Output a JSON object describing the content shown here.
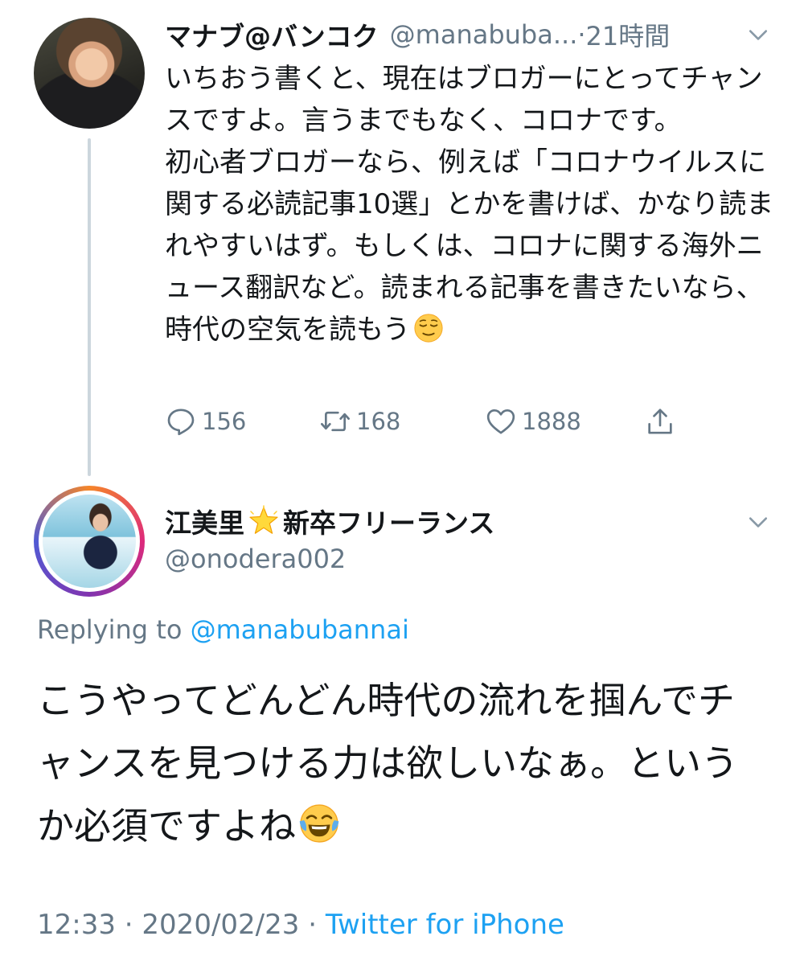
{
  "tweet1": {
    "author_name": "マナブ@バンコク",
    "author_handle": "@manabuba...",
    "time_separator": " · ",
    "time": "21時間",
    "body": "いちおう書くと、現在はブロガーにとってチャンスですよ。言うまでもなく、コロナです。\n初心者ブロガーなら、例えば「コロナウイルスに関する必読記事10選」とかを書けば、かなり読まれやすいはず。もしくは、コロナに関する海外ニュース翻訳など。読まれる記事を書きたいなら、時代の空気を読もう",
    "body_emoji": "relieved-face-emoji",
    "reply_count": "156",
    "retweet_count": "168",
    "like_count": "1888"
  },
  "tweet2": {
    "author_name_part1": "江美里",
    "name_emoji": "glowing-star-emoji",
    "author_name_part2": "新卒フリーランス",
    "author_handle": "@onodera002",
    "replying_prefix": "Replying to ",
    "replying_handle": "@manabubannai",
    "body": "こうやってどんどん時代の流れを掴んでチャンスを見つける力は欲しいなぁ。というか必須ですよね",
    "body_emoji": "face-with-tears-of-joy-emoji",
    "footer_time": "12:33",
    "footer_sep1": " · ",
    "footer_date": "2020/02/23",
    "footer_sep2": " · ",
    "footer_app": "Twitter for iPhone"
  },
  "colors": {
    "text": "#14171a",
    "secondary": "#657786",
    "link": "#1da1f2",
    "thread_line": "#ccd6dd"
  },
  "icons": [
    "chevron-down-icon",
    "reply-icon",
    "retweet-icon",
    "like-icon",
    "share-icon"
  ]
}
